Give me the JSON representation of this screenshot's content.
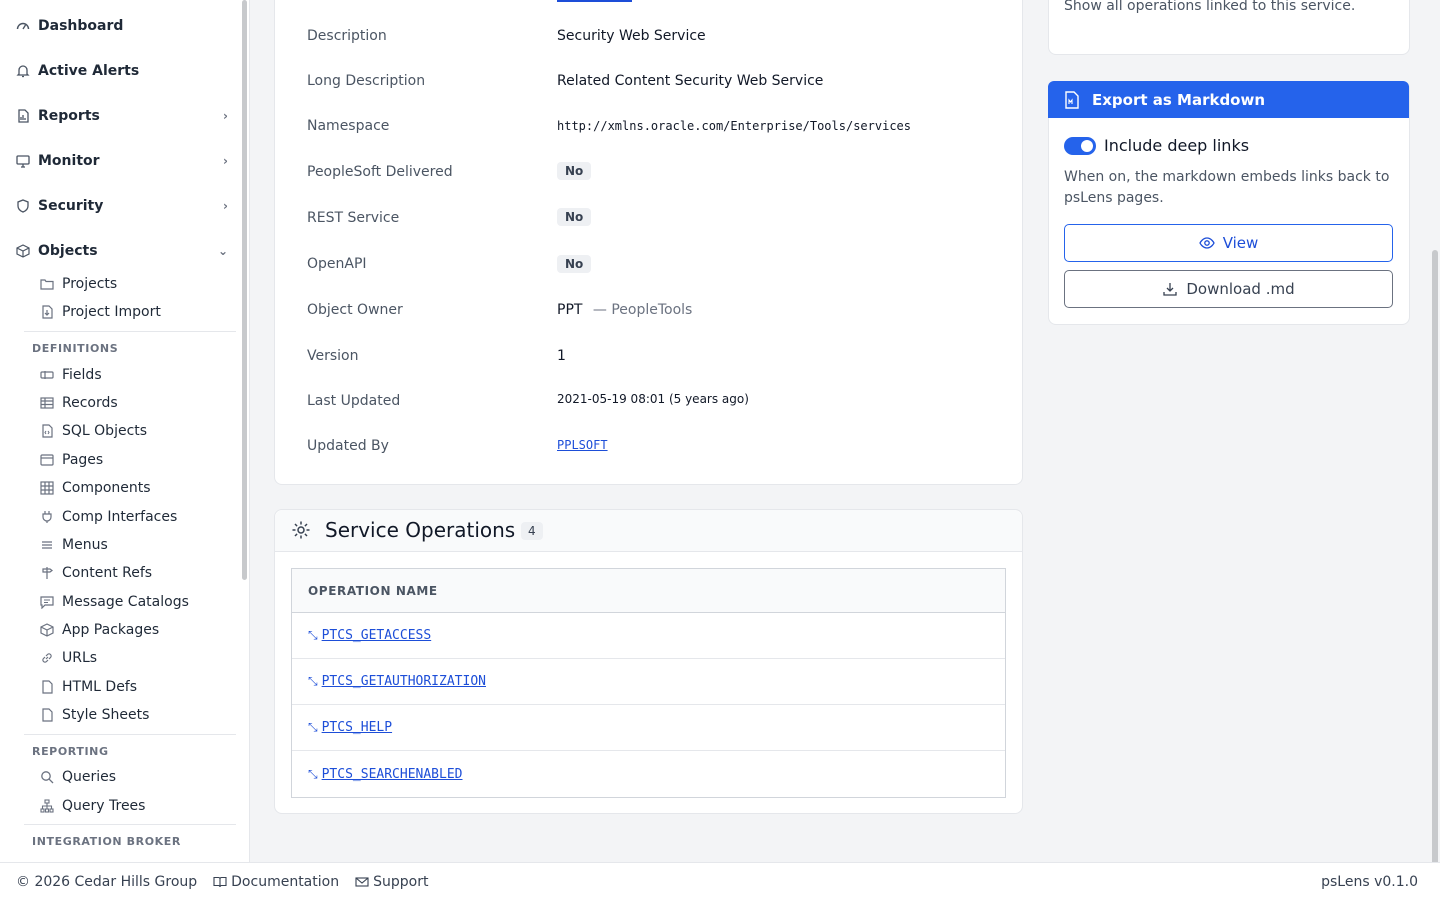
{
  "sidebar": {
    "top_items": [
      {
        "label": "Dashboard",
        "icon": "gauge-icon"
      },
      {
        "label": "Active Alerts",
        "icon": "bell-icon"
      },
      {
        "label": "Reports",
        "icon": "file-chart-icon"
      },
      {
        "label": "Monitor",
        "icon": "monitor-icon"
      },
      {
        "label": "Security",
        "icon": "shield-icon"
      },
      {
        "label": "Objects",
        "icon": "cube-icon"
      }
    ],
    "objects_items": [
      {
        "label": "Projects",
        "icon": "folder-icon"
      },
      {
        "label": "Project Import",
        "icon": "file-import-icon"
      }
    ],
    "definitions_heading": "DEFINITIONS",
    "definitions_items": [
      {
        "label": "Fields",
        "icon": "field-icon"
      },
      {
        "label": "Records",
        "icon": "table-icon"
      },
      {
        "label": "SQL Objects",
        "icon": "file-code-icon"
      },
      {
        "label": "Pages",
        "icon": "window-icon"
      },
      {
        "label": "Components",
        "icon": "grid-icon"
      },
      {
        "label": "Comp Interfaces",
        "icon": "plug-icon"
      },
      {
        "label": "Menus",
        "icon": "menu-icon"
      },
      {
        "label": "Content Refs",
        "icon": "signpost-icon"
      },
      {
        "label": "Message Catalogs",
        "icon": "message-icon"
      },
      {
        "label": "App Packages",
        "icon": "package-icon"
      },
      {
        "label": "URLs",
        "icon": "link-icon"
      },
      {
        "label": "HTML Defs",
        "icon": "file-html-icon"
      },
      {
        "label": "Style Sheets",
        "icon": "file-css-icon"
      }
    ],
    "reporting_heading": "REPORTING",
    "reporting_items": [
      {
        "label": "Queries",
        "icon": "search-icon"
      },
      {
        "label": "Query Trees",
        "icon": "tree-icon"
      }
    ],
    "integration_heading": "INTEGRATION BROKER"
  },
  "properties": [
    {
      "label": "Description",
      "value": "Security Web Service"
    },
    {
      "label": "Long Description",
      "value": "Related Content Security Web Service"
    },
    {
      "label": "Namespace",
      "value": "http://xmlns.oracle.com/Enterprise/Tools/services"
    },
    {
      "label": "PeopleSoft Delivered",
      "value": "No"
    },
    {
      "label": "REST Service",
      "value": "No"
    },
    {
      "label": "OpenAPI",
      "value": "No"
    },
    {
      "label": "Object Owner",
      "value": "PPT",
      "extra": "— PeopleTools"
    },
    {
      "label": "Version",
      "value": "1"
    },
    {
      "label": "Last Updated",
      "value": "2021-05-19 08:01 (5 years ago)"
    },
    {
      "label": "Updated By",
      "value": "PPLSOFT"
    }
  ],
  "service_operations": {
    "title": "Service Operations",
    "count": "4",
    "column_header": "OPERATION NAME",
    "rows": [
      "PTCS_GETACCESS",
      "PTCS_GETAUTHORIZATION",
      "PTCS_HELP",
      "PTCS_SEARCHENABLED"
    ]
  },
  "right_panel": {
    "ops_desc": "Show all operations linked to this service.",
    "export_title": "Export as Markdown",
    "toggle_label": "Include deep links",
    "toggle_on": true,
    "toggle_help": "When on, the markdown embeds links back to psLens pages.",
    "view_button": "View",
    "download_button": "Download .md"
  },
  "footer": {
    "copyright": "© 2026 Cedar Hills Group",
    "documentation": "Documentation",
    "support": "Support",
    "version": "psLens v0.1.0"
  },
  "colors": {
    "accent": "#2563eb",
    "link": "#1d4ed8"
  }
}
